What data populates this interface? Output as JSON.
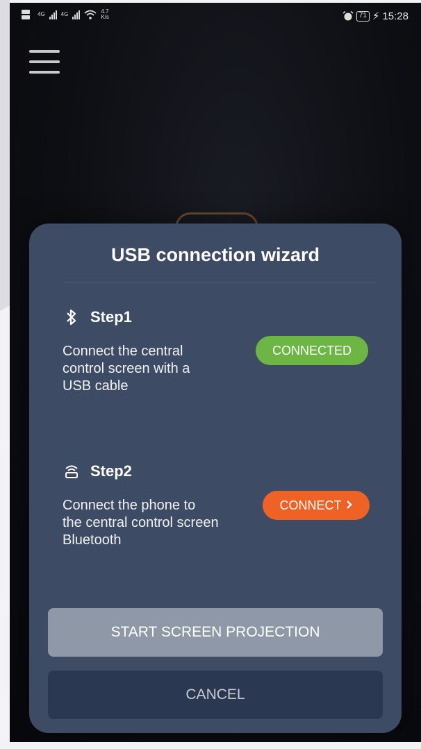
{
  "status_bar": {
    "net_speed_value": "4.7",
    "net_speed_unit": "K/s",
    "signal_label_1": "4G",
    "signal_label_2": "4G",
    "battery": "71",
    "time": "15:28"
  },
  "modal": {
    "title": "USB connection wizard",
    "step1": {
      "title": "Step1",
      "icon": "bluetooth-icon",
      "description_lines": [
        "Connect the central",
        "control screen with a",
        "USB cable"
      ],
      "status_label": "CONNECTED",
      "status_color": "#6db544"
    },
    "step2": {
      "title": "Step2",
      "icon": "router-icon",
      "description_lines": [
        "Connect the phone to",
        "the central control screen",
        "Bluetooth"
      ],
      "action_label": "CONNECT",
      "action_color": "#ee6226"
    },
    "start_button_label": "START SCREEN PROJECTION",
    "cancel_button_label": "CANCEL"
  }
}
